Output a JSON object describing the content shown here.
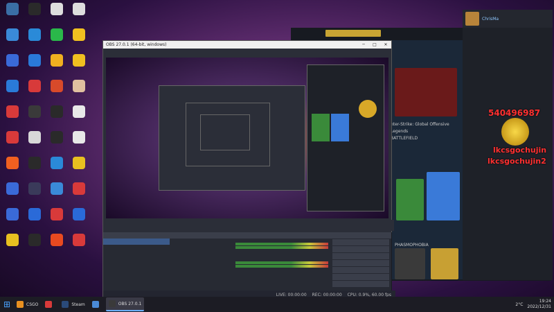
{
  "desktop_icons": [
    {
      "label": "",
      "color": "#3a6ea5"
    },
    {
      "label": "",
      "color": "#2a2a2a"
    },
    {
      "label": "",
      "color": "#dddddd"
    },
    {
      "label": "",
      "color": "#dddddd"
    },
    {
      "label": "",
      "color": "#3a8ad8"
    },
    {
      "label": "",
      "color": "#2a8ad8"
    },
    {
      "label": "",
      "color": "#2ab84a"
    },
    {
      "label": "",
      "color": "#f0c020"
    },
    {
      "label": "",
      "color": "#3a6ad8"
    },
    {
      "label": "",
      "color": "#2a7ad8"
    },
    {
      "label": "",
      "color": "#f0b020"
    },
    {
      "label": "",
      "color": "#f0c020"
    },
    {
      "label": "",
      "color": "#2a7ad8"
    },
    {
      "label": "",
      "color": "#d83a3a"
    },
    {
      "label": "",
      "color": "#d84a2a"
    },
    {
      "label": "",
      "color": "#e0c0a0"
    },
    {
      "label": "",
      "color": "#d83a3a"
    },
    {
      "label": "",
      "color": "#3a3a3a"
    },
    {
      "label": "",
      "color": "#2a2a2a"
    },
    {
      "label": "",
      "color": "#e8e8e8"
    },
    {
      "label": "",
      "color": "#d83a3a"
    },
    {
      "label": "",
      "color": "#d8d8d8"
    },
    {
      "label": "",
      "color": "#2a2a2a"
    },
    {
      "label": "",
      "color": "#e8e8e8"
    },
    {
      "label": "",
      "color": "#f06020"
    },
    {
      "label": "",
      "color": "#2a2a2a"
    },
    {
      "label": "",
      "color": "#2a8ad8"
    },
    {
      "label": "",
      "color": "#e8c020"
    },
    {
      "label": "",
      "color": "#3a6ad8"
    },
    {
      "label": "",
      "color": "#3a3a5a"
    },
    {
      "label": "",
      "color": "#3a8ad8"
    },
    {
      "label": "",
      "color": "#d83a3a"
    },
    {
      "label": "",
      "color": "#3a6ad8"
    },
    {
      "label": "",
      "color": "#2a6ad8"
    },
    {
      "label": "",
      "color": "#d83a3a"
    },
    {
      "label": "",
      "color": "#2a6ad8"
    },
    {
      "label": "",
      "color": "#e8c020"
    },
    {
      "label": "",
      "color": "#2a2a2a"
    },
    {
      "label": "",
      "color": "#e84a20"
    },
    {
      "label": "",
      "color": "#d83a3a"
    }
  ],
  "taskbar": {
    "items": [
      {
        "label": "CSGO",
        "color": "#e89020",
        "active": false
      },
      {
        "label": "",
        "color": "#d83a3a",
        "active": false
      },
      {
        "label": "Steam",
        "color": "#2a4a7a",
        "active": false
      },
      {
        "label": "",
        "color": "#4a8ad8",
        "active": false
      },
      {
        "label": "OBS 27.0.1",
        "color": "#3a3a3a",
        "active": true
      }
    ],
    "weather": "2°C",
    "time": "19:24",
    "date": "2022/12/31"
  },
  "obs": {
    "title": "OBS 27.0.1 (64-bit, windows)",
    "menu": [
      "",
      "",
      "",
      "",
      "",
      "",
      ""
    ],
    "scenes_header": "",
    "sources_header": "",
    "mixer_header": "",
    "controls_header": "",
    "scenes": [
      "",
      ""
    ],
    "sources": [
      "",
      "",
      "",
      "",
      "",
      "",
      "",
      ""
    ],
    "controls": [
      "",
      "",
      "",
      "",
      "",
      "",
      ""
    ],
    "status_live": "LIVE: 00:00:00",
    "status_rec": "REC: 00:00:00",
    "status_cpu": "CPU: 0.9%, 60.00 fps"
  },
  "friends": {
    "username": "ChrisMa"
  },
  "overlay": {
    "line1": "",
    "line2": "540496987",
    "line3": "lkcsgochujin",
    "line4": "lkcsgochujin2"
  },
  "steam": {
    "game_csgo": "nter-Strike: Global Offensive",
    "game_legends": "Legends",
    "game_battlefield": "BATTLEFIELD",
    "game_phasmophobia": "PHASMOPHOBIA"
  }
}
